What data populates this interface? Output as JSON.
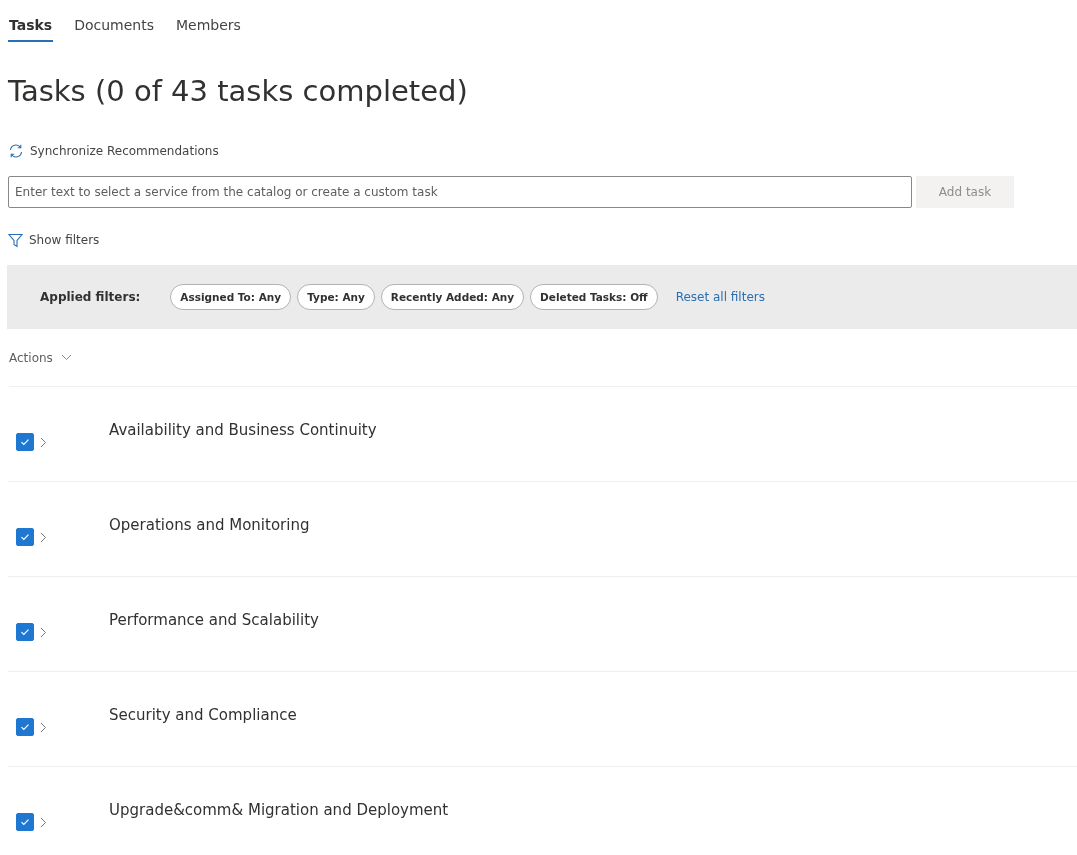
{
  "tabs": [
    {
      "label": "Tasks",
      "selected": true
    },
    {
      "label": "Documents",
      "selected": false
    },
    {
      "label": "Members",
      "selected": false
    }
  ],
  "heading": "Tasks (0 of 43 tasks completed)",
  "sync_link": "Synchronize Recommendations",
  "task_input": {
    "placeholder": "Enter text to select a service from the catalog or create a custom task"
  },
  "add_button": {
    "label": "Add task",
    "disabled": true
  },
  "show_filters": "Show filters",
  "filter_bar": {
    "label": "Applied filters:",
    "chips": [
      "Assigned To: Any",
      "Type: Any",
      "Recently Added: Any",
      "Deleted Tasks: Off"
    ],
    "reset": "Reset all filters"
  },
  "actions_menu": "Actions",
  "groups": [
    {
      "title": "Availability and Business Continuity",
      "checked": true
    },
    {
      "title": "Operations and Monitoring",
      "checked": true
    },
    {
      "title": "Performance and Scalability",
      "checked": true
    },
    {
      "title": "Security and Compliance",
      "checked": true
    },
    {
      "title": "Upgrade&comm& Migration and Deployment",
      "checked": true
    }
  ]
}
